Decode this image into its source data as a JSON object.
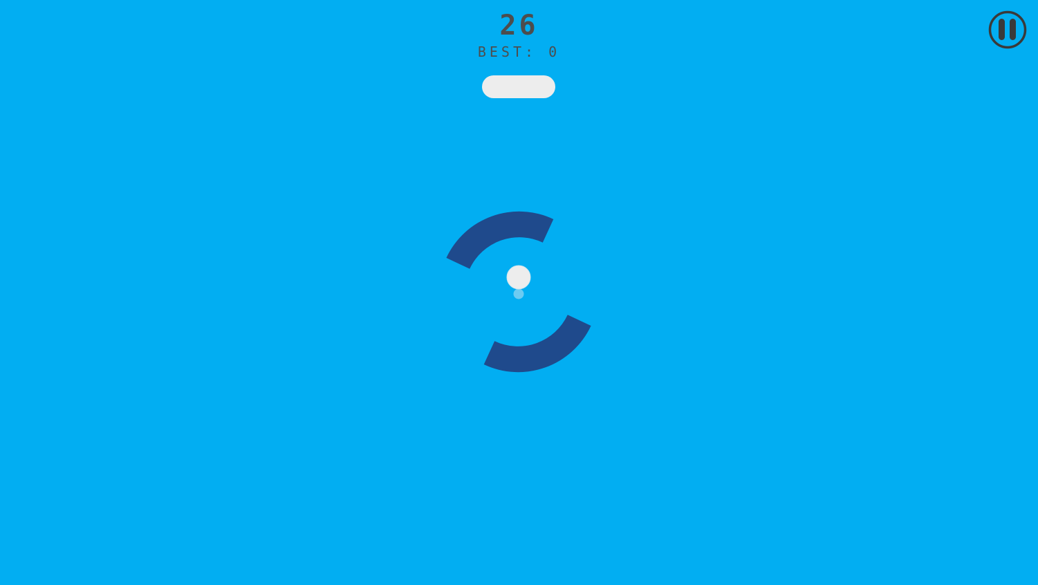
{
  "hud": {
    "score": "26",
    "best_label": "BEST:",
    "best_value": "0",
    "pause_icon": "pause-icon"
  },
  "colors": {
    "background": "#02AEF2",
    "ring_segment": "#1F4A8C",
    "ball": "#EDEDED",
    "trail_dot": "#6CCBF2",
    "text": "#4D4D4D",
    "pill": "#EDEDED"
  }
}
